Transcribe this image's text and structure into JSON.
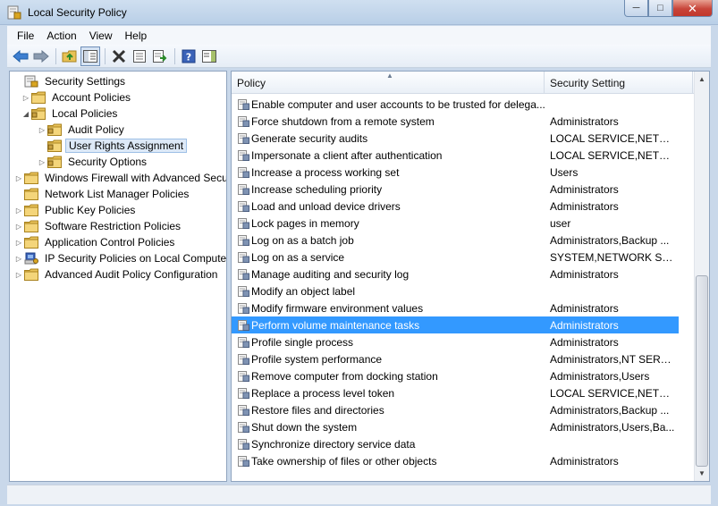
{
  "window": {
    "title": "Local Security Policy"
  },
  "menu": [
    "File",
    "Action",
    "View",
    "Help"
  ],
  "tree": [
    {
      "label": "Security Settings",
      "toggle": "",
      "depth": 0,
      "icon": "shield-settings-icon"
    },
    {
      "label": "Account Policies",
      "toggle": "▷",
      "depth": 1,
      "icon": "folder-icon"
    },
    {
      "label": "Local Policies",
      "toggle": "◢",
      "depth": 1,
      "icon": "folder-icon"
    },
    {
      "label": "Audit Policy",
      "toggle": "▷",
      "depth": 2,
      "icon": "folder-icon"
    },
    {
      "label": "User Rights Assignment",
      "toggle": "",
      "depth": 2,
      "icon": "folder-icon",
      "selected": true
    },
    {
      "label": "Security Options",
      "toggle": "▷",
      "depth": 2,
      "icon": "folder-icon"
    },
    {
      "label": "Windows Firewall with Advanced Secu",
      "toggle": "▷",
      "depth": 0,
      "icon": "folder-icon"
    },
    {
      "label": "Network List Manager Policies",
      "toggle": "",
      "depth": 0,
      "icon": "folder-icon"
    },
    {
      "label": "Public Key Policies",
      "toggle": "▷",
      "depth": 0,
      "icon": "folder-icon"
    },
    {
      "label": "Software Restriction Policies",
      "toggle": "▷",
      "depth": 0,
      "icon": "folder-icon"
    },
    {
      "label": "Application Control Policies",
      "toggle": "▷",
      "depth": 0,
      "icon": "folder-icon"
    },
    {
      "label": "IP Security Policies on Local Compute",
      "toggle": "▷",
      "depth": 0,
      "icon": "ip-security-icon"
    },
    {
      "label": "Advanced Audit Policy Configuration",
      "toggle": "▷",
      "depth": 0,
      "icon": "folder-icon"
    }
  ],
  "list": {
    "columns": {
      "policy": "Policy",
      "setting": "Security Setting"
    },
    "rows": [
      {
        "policy": "Enable computer and user accounts to be trusted for delega...",
        "setting": ""
      },
      {
        "policy": "Force shutdown from a remote system",
        "setting": "Administrators"
      },
      {
        "policy": "Generate security audits",
        "setting": "LOCAL SERVICE,NETWO..."
      },
      {
        "policy": "Impersonate a client after authentication",
        "setting": "LOCAL SERVICE,NETWO..."
      },
      {
        "policy": "Increase a process working set",
        "setting": "Users"
      },
      {
        "policy": "Increase scheduling priority",
        "setting": "Administrators"
      },
      {
        "policy": "Load and unload device drivers",
        "setting": "Administrators"
      },
      {
        "policy": "Lock pages in memory",
        "setting": "user"
      },
      {
        "policy": "Log on as a batch job",
        "setting": "Administrators,Backup ..."
      },
      {
        "policy": "Log on as a service",
        "setting": "SYSTEM,NETWORK SER..."
      },
      {
        "policy": "Manage auditing and security log",
        "setting": "Administrators"
      },
      {
        "policy": "Modify an object label",
        "setting": ""
      },
      {
        "policy": "Modify firmware environment values",
        "setting": "Administrators"
      },
      {
        "policy": "Perform volume maintenance tasks",
        "setting": "Administrators",
        "selected": true
      },
      {
        "policy": "Profile single process",
        "setting": "Administrators"
      },
      {
        "policy": "Profile system performance",
        "setting": "Administrators,NT SERVI..."
      },
      {
        "policy": "Remove computer from docking station",
        "setting": "Administrators,Users"
      },
      {
        "policy": "Replace a process level token",
        "setting": "LOCAL SERVICE,NETWO..."
      },
      {
        "policy": "Restore files and directories",
        "setting": "Administrators,Backup ..."
      },
      {
        "policy": "Shut down the system",
        "setting": "Administrators,Users,Ba..."
      },
      {
        "policy": "Synchronize directory service data",
        "setting": ""
      },
      {
        "policy": "Take ownership of files or other objects",
        "setting": "Administrators"
      }
    ]
  },
  "colors": {
    "selection": "#3399ff",
    "titlebar": "#c2d5ea",
    "tree_selection": "#dde9f7"
  }
}
